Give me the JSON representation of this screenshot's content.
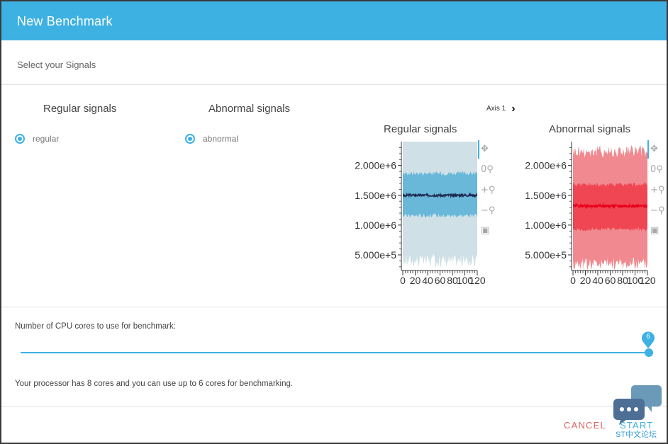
{
  "dialog": {
    "title": "New Benchmark",
    "subtitle": "Select your Signals"
  },
  "signals": {
    "regular_title": "Regular signals",
    "abnormal_title": "Abnormal signals",
    "regular_option": "regular",
    "abnormal_option": "abnormal"
  },
  "axis_selector": {
    "label": "Axis 1"
  },
  "toolbar": {
    "icons": [
      "pan-icon",
      "reset-zoom-icon",
      "zoom-in-icon",
      "zoom-out-icon",
      "save-icon"
    ]
  },
  "charts": {
    "regular": {
      "title": "Regular signals"
    },
    "abnormal": {
      "title": "Abnormal signals"
    }
  },
  "chart_data": [
    {
      "type": "area",
      "title": "Regular signals",
      "x_ticks": [
        "0",
        "20",
        "40",
        "60",
        "80",
        "100",
        "120"
      ],
      "y_ticks": [
        "5.000e+5",
        "1.000e+6",
        "1.500e+6",
        "2.000e+6"
      ],
      "xlim": [
        0,
        120
      ],
      "ylim": [
        250000,
        2400000
      ],
      "colors": {
        "outer": "#cfe1e6",
        "inner": "#6ab8d9",
        "mean": "#1e2a50"
      },
      "bands": {
        "outer": [
          400000,
          2500000
        ],
        "inner": [
          1160000,
          1870000
        ],
        "mean": 1500000
      }
    },
    {
      "type": "area",
      "title": "Abnormal signals",
      "x_ticks": [
        "0",
        "20",
        "40",
        "60",
        "80",
        "100",
        "120"
      ],
      "y_ticks": [
        "5.000e+5",
        "1.000e+6",
        "1.500e+6",
        "2.000e+6"
      ],
      "xlim": [
        0,
        120
      ],
      "ylim": [
        250000,
        2400000
      ],
      "colors": {
        "outer": "#f08a90",
        "inner": "#f04552",
        "mean": "#e8001a"
      },
      "bands": {
        "outer": [
          350000,
          2240000
        ],
        "inner": [
          930000,
          1680000
        ],
        "mean": 1320000
      }
    }
  ],
  "cpu": {
    "label": "Number of CPU cores to use for benchmark:",
    "value": "6",
    "min": 1,
    "max": 6,
    "info": "Your processor has 8 cores and you can use up to 6 cores for benchmarking."
  },
  "actions": {
    "cancel": "CANCEL",
    "start": "START"
  },
  "watermark": {
    "text": "ST中文论坛"
  },
  "colors": {
    "accent": "#3eb1e3",
    "cancel": "#e06464"
  }
}
